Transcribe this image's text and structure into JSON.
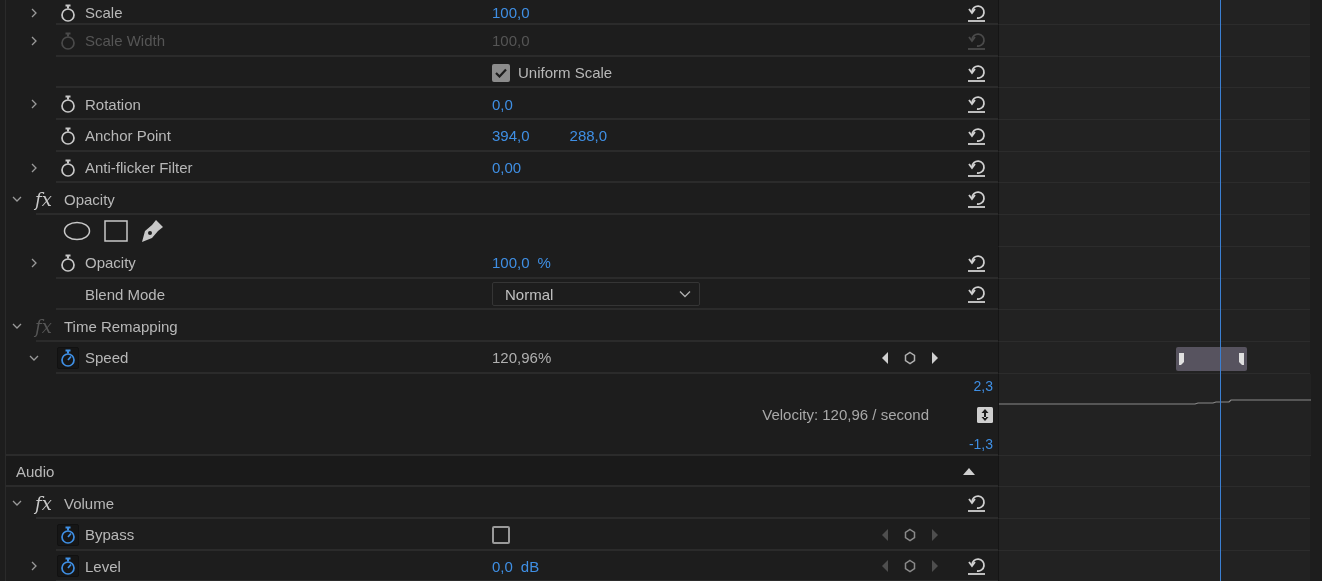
{
  "rows": [
    {
      "kind": "property",
      "expanded": false,
      "label": "Scale",
      "animated": false,
      "disabled": false,
      "scrubbable": true,
      "values": [
        "100,0"
      ],
      "reset": true
    },
    {
      "kind": "property",
      "expanded": false,
      "label": "Scale Width",
      "animated": false,
      "disabled": true,
      "scrubbable": true,
      "values": [
        "100,0"
      ],
      "reset": true
    },
    {
      "kind": "option",
      "label": "Uniform Scale",
      "checked": true,
      "reset": true
    },
    {
      "kind": "property",
      "expanded": false,
      "label": "Rotation",
      "animated": false,
      "disabled": false,
      "scrubbable": true,
      "values": [
        "0,0"
      ],
      "reset": true
    },
    {
      "kind": "property",
      "label": "Anchor Point",
      "animated": false,
      "disabled": false,
      "scrubbable": true,
      "values": [
        "394,0",
        "288,0"
      ],
      "reset": true
    },
    {
      "kind": "property",
      "expanded": false,
      "label": "Anti-flicker Filter",
      "animated": false,
      "disabled": false,
      "scrubbable": true,
      "values": [
        "0,00"
      ],
      "reset": true
    },
    {
      "kind": "effect",
      "expanded": true,
      "badge": "fx",
      "fx_enabled": true,
      "label": "Opacity",
      "reset": true
    },
    {
      "kind": "masks"
    },
    {
      "kind": "property",
      "expanded": false,
      "label": "Opacity",
      "animated": false,
      "disabled": false,
      "scrubbable": true,
      "values": [
        "100,0"
      ],
      "unit": "%",
      "reset": true
    },
    {
      "kind": "dropdown",
      "label": "Blend Mode",
      "value": "Normal",
      "reset": true
    },
    {
      "kind": "effect",
      "expanded": true,
      "badge": "fx",
      "fx_enabled": false,
      "label": "Time Remapping",
      "reset": false
    },
    {
      "kind": "property",
      "expanded": true,
      "label": "Speed",
      "animated": true,
      "disabled": false,
      "scrubbable": false,
      "values": [
        "120,96%"
      ],
      "keyframes_enabled": true,
      "reset": false,
      "clip_bar": true
    },
    {
      "kind": "velocity",
      "max": "2,3",
      "text": "Velocity: 120,96 / second",
      "min": "-1,3"
    },
    {
      "kind": "section",
      "label": "Audio",
      "expanded": true
    },
    {
      "kind": "effect",
      "expanded": true,
      "badge": "fx",
      "fx_enabled": true,
      "label": "Volume",
      "reset": true
    },
    {
      "kind": "property",
      "label": "Bypass",
      "animated": true,
      "disabled": false,
      "checked": false,
      "keyframes_enabled": false,
      "reset": false
    },
    {
      "kind": "property",
      "expanded": false,
      "label": "Level",
      "animated": true,
      "disabled": false,
      "scrubbable": true,
      "values": [
        "0,0"
      ],
      "unit": "dB",
      "keyframes_enabled": false,
      "reset": true
    }
  ]
}
